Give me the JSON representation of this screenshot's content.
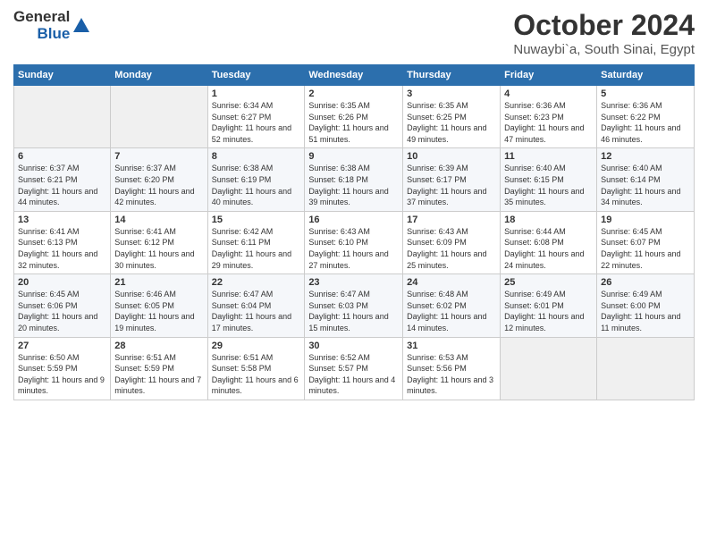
{
  "logo": {
    "general": "General",
    "blue": "Blue"
  },
  "header": {
    "month": "October 2024",
    "location": "Nuwaybi`a, South Sinai, Egypt"
  },
  "columns": [
    "Sunday",
    "Monday",
    "Tuesday",
    "Wednesday",
    "Thursday",
    "Friday",
    "Saturday"
  ],
  "weeks": [
    [
      {
        "day": "",
        "sunrise": "",
        "sunset": "",
        "daylight": ""
      },
      {
        "day": "",
        "sunrise": "",
        "sunset": "",
        "daylight": ""
      },
      {
        "day": "1",
        "sunrise": "Sunrise: 6:34 AM",
        "sunset": "Sunset: 6:27 PM",
        "daylight": "Daylight: 11 hours and 52 minutes."
      },
      {
        "day": "2",
        "sunrise": "Sunrise: 6:35 AM",
        "sunset": "Sunset: 6:26 PM",
        "daylight": "Daylight: 11 hours and 51 minutes."
      },
      {
        "day": "3",
        "sunrise": "Sunrise: 6:35 AM",
        "sunset": "Sunset: 6:25 PM",
        "daylight": "Daylight: 11 hours and 49 minutes."
      },
      {
        "day": "4",
        "sunrise": "Sunrise: 6:36 AM",
        "sunset": "Sunset: 6:23 PM",
        "daylight": "Daylight: 11 hours and 47 minutes."
      },
      {
        "day": "5",
        "sunrise": "Sunrise: 6:36 AM",
        "sunset": "Sunset: 6:22 PM",
        "daylight": "Daylight: 11 hours and 46 minutes."
      }
    ],
    [
      {
        "day": "6",
        "sunrise": "Sunrise: 6:37 AM",
        "sunset": "Sunset: 6:21 PM",
        "daylight": "Daylight: 11 hours and 44 minutes."
      },
      {
        "day": "7",
        "sunrise": "Sunrise: 6:37 AM",
        "sunset": "Sunset: 6:20 PM",
        "daylight": "Daylight: 11 hours and 42 minutes."
      },
      {
        "day": "8",
        "sunrise": "Sunrise: 6:38 AM",
        "sunset": "Sunset: 6:19 PM",
        "daylight": "Daylight: 11 hours and 40 minutes."
      },
      {
        "day": "9",
        "sunrise": "Sunrise: 6:38 AM",
        "sunset": "Sunset: 6:18 PM",
        "daylight": "Daylight: 11 hours and 39 minutes."
      },
      {
        "day": "10",
        "sunrise": "Sunrise: 6:39 AM",
        "sunset": "Sunset: 6:17 PM",
        "daylight": "Daylight: 11 hours and 37 minutes."
      },
      {
        "day": "11",
        "sunrise": "Sunrise: 6:40 AM",
        "sunset": "Sunset: 6:15 PM",
        "daylight": "Daylight: 11 hours and 35 minutes."
      },
      {
        "day": "12",
        "sunrise": "Sunrise: 6:40 AM",
        "sunset": "Sunset: 6:14 PM",
        "daylight": "Daylight: 11 hours and 34 minutes."
      }
    ],
    [
      {
        "day": "13",
        "sunrise": "Sunrise: 6:41 AM",
        "sunset": "Sunset: 6:13 PM",
        "daylight": "Daylight: 11 hours and 32 minutes."
      },
      {
        "day": "14",
        "sunrise": "Sunrise: 6:41 AM",
        "sunset": "Sunset: 6:12 PM",
        "daylight": "Daylight: 11 hours and 30 minutes."
      },
      {
        "day": "15",
        "sunrise": "Sunrise: 6:42 AM",
        "sunset": "Sunset: 6:11 PM",
        "daylight": "Daylight: 11 hours and 29 minutes."
      },
      {
        "day": "16",
        "sunrise": "Sunrise: 6:43 AM",
        "sunset": "Sunset: 6:10 PM",
        "daylight": "Daylight: 11 hours and 27 minutes."
      },
      {
        "day": "17",
        "sunrise": "Sunrise: 6:43 AM",
        "sunset": "Sunset: 6:09 PM",
        "daylight": "Daylight: 11 hours and 25 minutes."
      },
      {
        "day": "18",
        "sunrise": "Sunrise: 6:44 AM",
        "sunset": "Sunset: 6:08 PM",
        "daylight": "Daylight: 11 hours and 24 minutes."
      },
      {
        "day": "19",
        "sunrise": "Sunrise: 6:45 AM",
        "sunset": "Sunset: 6:07 PM",
        "daylight": "Daylight: 11 hours and 22 minutes."
      }
    ],
    [
      {
        "day": "20",
        "sunrise": "Sunrise: 6:45 AM",
        "sunset": "Sunset: 6:06 PM",
        "daylight": "Daylight: 11 hours and 20 minutes."
      },
      {
        "day": "21",
        "sunrise": "Sunrise: 6:46 AM",
        "sunset": "Sunset: 6:05 PM",
        "daylight": "Daylight: 11 hours and 19 minutes."
      },
      {
        "day": "22",
        "sunrise": "Sunrise: 6:47 AM",
        "sunset": "Sunset: 6:04 PM",
        "daylight": "Daylight: 11 hours and 17 minutes."
      },
      {
        "day": "23",
        "sunrise": "Sunrise: 6:47 AM",
        "sunset": "Sunset: 6:03 PM",
        "daylight": "Daylight: 11 hours and 15 minutes."
      },
      {
        "day": "24",
        "sunrise": "Sunrise: 6:48 AM",
        "sunset": "Sunset: 6:02 PM",
        "daylight": "Daylight: 11 hours and 14 minutes."
      },
      {
        "day": "25",
        "sunrise": "Sunrise: 6:49 AM",
        "sunset": "Sunset: 6:01 PM",
        "daylight": "Daylight: 11 hours and 12 minutes."
      },
      {
        "day": "26",
        "sunrise": "Sunrise: 6:49 AM",
        "sunset": "Sunset: 6:00 PM",
        "daylight": "Daylight: 11 hours and 11 minutes."
      }
    ],
    [
      {
        "day": "27",
        "sunrise": "Sunrise: 6:50 AM",
        "sunset": "Sunset: 5:59 PM",
        "daylight": "Daylight: 11 hours and 9 minutes."
      },
      {
        "day": "28",
        "sunrise": "Sunrise: 6:51 AM",
        "sunset": "Sunset: 5:59 PM",
        "daylight": "Daylight: 11 hours and 7 minutes."
      },
      {
        "day": "29",
        "sunrise": "Sunrise: 6:51 AM",
        "sunset": "Sunset: 5:58 PM",
        "daylight": "Daylight: 11 hours and 6 minutes."
      },
      {
        "day": "30",
        "sunrise": "Sunrise: 6:52 AM",
        "sunset": "Sunset: 5:57 PM",
        "daylight": "Daylight: 11 hours and 4 minutes."
      },
      {
        "day": "31",
        "sunrise": "Sunrise: 6:53 AM",
        "sunset": "Sunset: 5:56 PM",
        "daylight": "Daylight: 11 hours and 3 minutes."
      },
      {
        "day": "",
        "sunrise": "",
        "sunset": "",
        "daylight": ""
      },
      {
        "day": "",
        "sunrise": "",
        "sunset": "",
        "daylight": ""
      }
    ]
  ]
}
